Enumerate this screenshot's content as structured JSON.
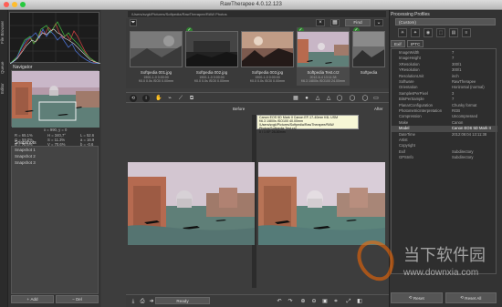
{
  "window": {
    "title": "RawTherapee 4.0.12.123"
  },
  "left": {
    "vtabs": [
      "File Browser",
      "Queue",
      "Editor"
    ],
    "navigator_label": "Navigator",
    "navinfo": {
      "coords": "x = 990, y = 0",
      "r": "R = 65.1%",
      "h": "H = 340,7°",
      "l": "L = 52.6",
      "g": "G = 59.0%",
      "s": "S = 11.3%",
      "a": "a = 16.9",
      "b": "B = 70.6%",
      "v": "V = 70.6%",
      "bb": "b = -0.6"
    },
    "snapshots_label": "Snapshots",
    "snapshots": [
      "Snapshot 1",
      "Snapshot 2",
      "Snapshot 3"
    ],
    "add_label": "Add",
    "del_label": "Del"
  },
  "filmstrip": {
    "path": "/Users/svgk/Pictures/Softpedia/RawTherapee/RAW Photos",
    "find_label": "Find",
    "thumbs": [
      {
        "name": "Softpedia 001.jpg",
        "info": "1900-1-0 0:00:00",
        "info2": "f/0.0 0.0s ISO0 0.00mm",
        "checked": false,
        "selected": false
      },
      {
        "name": "Softpedia 002.jpg",
        "info": "1900-1-0 0:00:00",
        "info2": "f/0.0 0.0s ISO0 0.00mm",
        "checked": true,
        "selected": false
      },
      {
        "name": "Softpedia 003.jpg",
        "info": "1900-1-0 0:00:00",
        "info2": "f/0.0 0.0s ISO0 0.00mm",
        "checked": false,
        "selected": false
      },
      {
        "name": "Softpedia Test.cr2",
        "info": "2012-6-4 13:11:38",
        "info2": "f/6.3 1/800s ISO100 24.00mm",
        "checked": true,
        "selected": true
      },
      {
        "name": "Softpedia",
        "info": "",
        "info2": "",
        "checked": false,
        "selected": false
      }
    ]
  },
  "editor": {
    "before_label": "Before",
    "after_label": "After",
    "tooltip": {
      "line1": "Canon EOS 5D Mark II Canon EF-17-40mm f/4L USM",
      "line2": "f/6.3 1/800s ISO100 40.00mm",
      "line3": "/Users/svgk/Pictures/Softpedia/RawTherapee/RAW Photos/Softpedia Test.cr2",
      "line4": "0 / 1 EF 28-80mm"
    },
    "status": "Ready"
  },
  "right": {
    "profiles_label": "Processing Profiles",
    "profile_value": "(Custom)",
    "tabs": [
      "Exif",
      "IPTC"
    ],
    "metadata": [
      {
        "k": "ImageWidth",
        "v": "7"
      },
      {
        "k": "ImageHeight",
        "v": "7"
      },
      {
        "k": "XResolution",
        "v": "300/1"
      },
      {
        "k": "YResolution",
        "v": "300/1"
      },
      {
        "k": "ResolutionUnit",
        "v": "inch"
      },
      {
        "k": "Software",
        "v": "RawTherapee"
      },
      {
        "k": "Orientation",
        "v": "Horizontal (normal)"
      },
      {
        "k": "SamplesPerPixel",
        "v": "3"
      },
      {
        "k": "BitsPerSample",
        "v": "7"
      },
      {
        "k": "PlanarConfiguration",
        "v": "Chunky format"
      },
      {
        "k": "PhotometricInterpretation",
        "v": "RGB"
      },
      {
        "k": "Compression",
        "v": "Uncompressed"
      },
      {
        "k": "Make",
        "v": "Canon"
      },
      {
        "k": "Model",
        "v": "Canon EOS 5D Mark II",
        "sel": true
      },
      {
        "k": "DateTime",
        "v": "2012:06:04 13:11:38"
      },
      {
        "k": "Artist",
        "v": ""
      },
      {
        "k": "Copyright",
        "v": ""
      },
      {
        "k": "Exif",
        "v": "Subdirectory"
      },
      {
        "k": "GPSInfo",
        "v": "Subdirectory"
      }
    ],
    "reset_label": "Reset",
    "reset_all_label": "Reset All"
  },
  "colors": {
    "accent": "#2f7f2f",
    "panel": "#333333",
    "dark": "#2b2b2b"
  }
}
